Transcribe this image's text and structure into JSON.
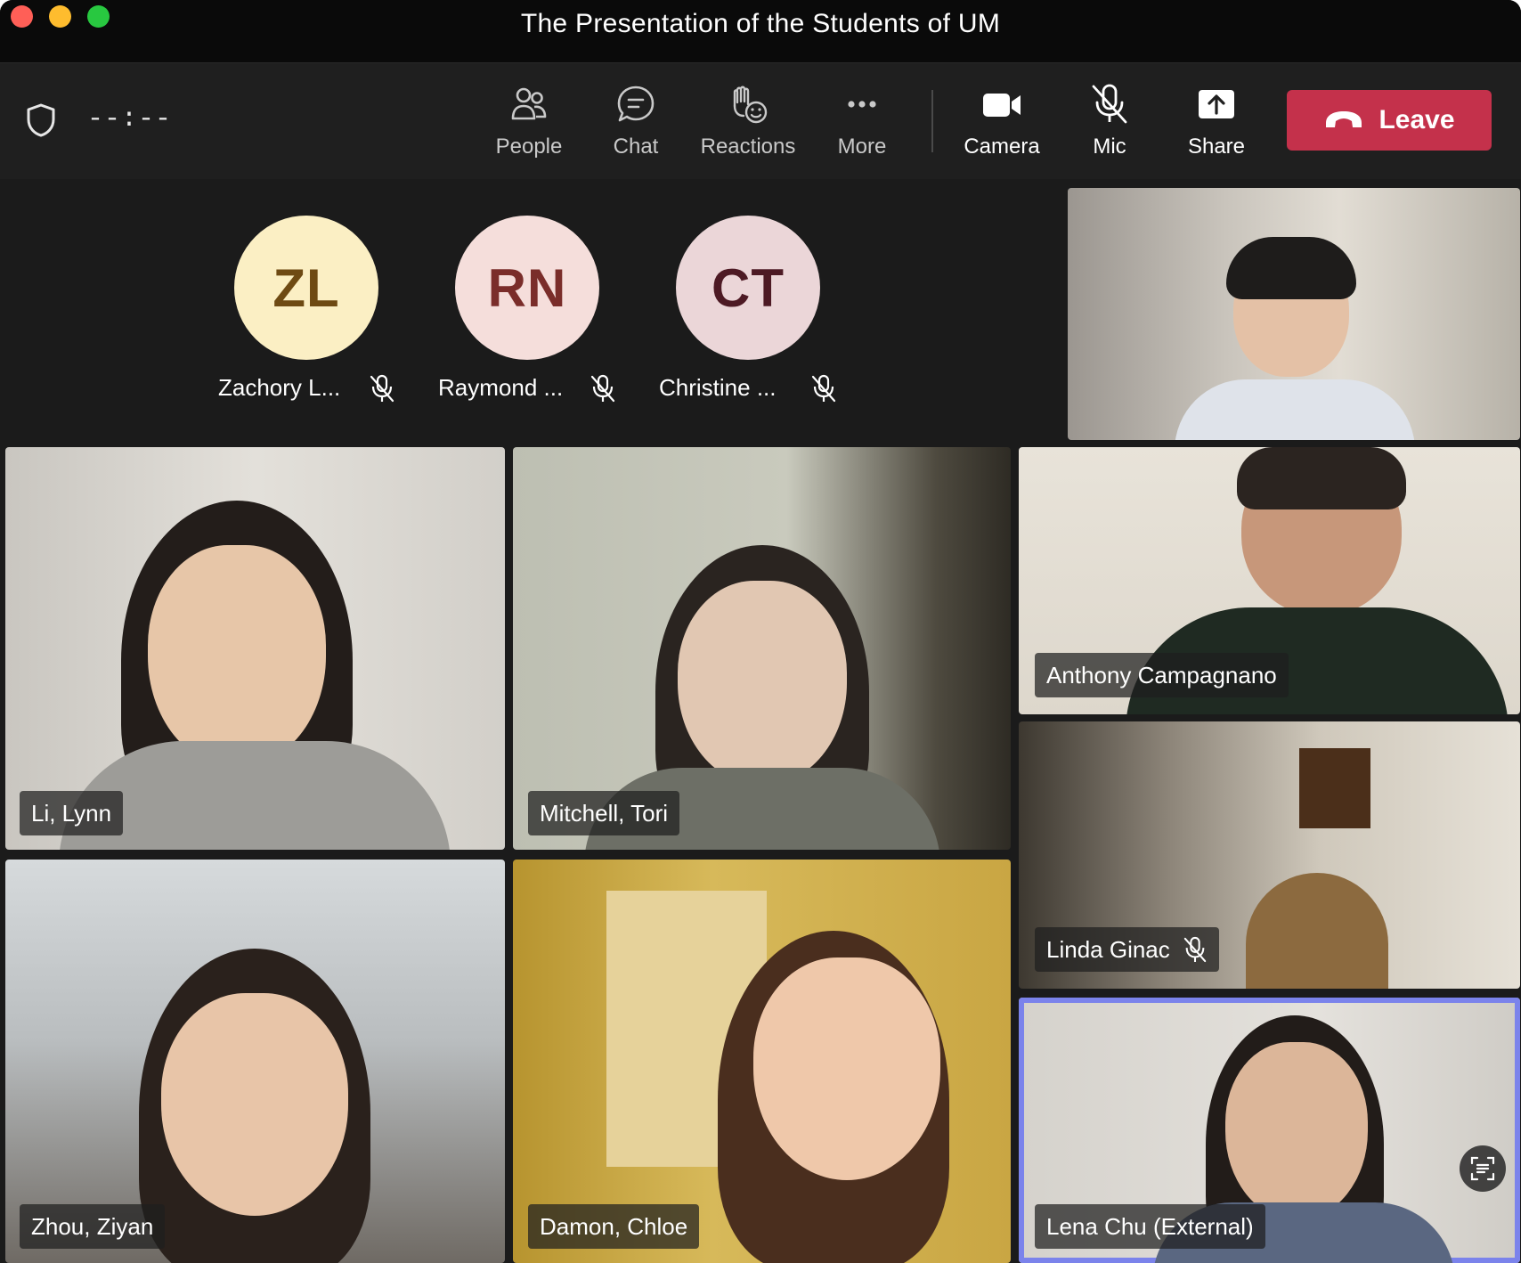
{
  "window": {
    "title": "The Presentation of the Students of UM"
  },
  "toolbar": {
    "timer": "--:--",
    "people_label": "People",
    "chat_label": "Chat",
    "reactions_label": "Reactions",
    "more_label": "More",
    "camera_label": "Camera",
    "mic_label": "Mic",
    "share_label": "Share",
    "leave_label": "Leave"
  },
  "audio_participants": [
    {
      "initials": "ZL",
      "name": "Zachory L...",
      "muted": true,
      "color": "#fbefc4"
    },
    {
      "initials": "RN",
      "name": "Raymond ...",
      "muted": true,
      "color": "#f5dedb"
    },
    {
      "initials": "CT",
      "name": "Christine ...",
      "muted": true,
      "color": "#ebd6d8"
    }
  ],
  "video_participants": [
    {
      "name": "Li, Lynn"
    },
    {
      "name": "Mitchell, Tori"
    },
    {
      "name": "Anthony Campagnano"
    },
    {
      "name": "Linda Ginac",
      "muted": true
    },
    {
      "name": "Zhou, Ziyan"
    },
    {
      "name": "Damon, Chloe"
    },
    {
      "name": "Lena Chu (External)",
      "speaking": true
    }
  ],
  "colors": {
    "leave": "#c4314b",
    "speaking_outline": "#7b83eb",
    "background": "#1b1b1b"
  }
}
